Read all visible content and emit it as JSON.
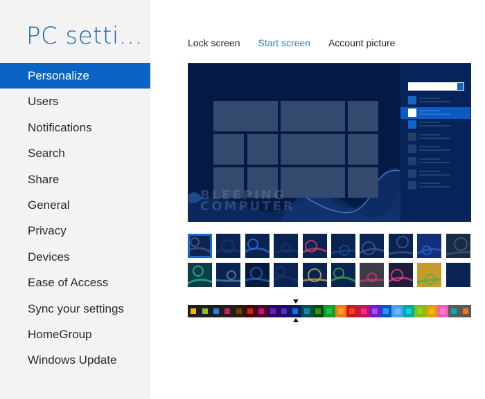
{
  "app": {
    "title": "PC setti..."
  },
  "sidebar": {
    "items": [
      {
        "label": "Personalize",
        "selected": true
      },
      {
        "label": "Users"
      },
      {
        "label": "Notifications"
      },
      {
        "label": "Search"
      },
      {
        "label": "Share"
      },
      {
        "label": "General"
      },
      {
        "label": "Privacy"
      },
      {
        "label": "Devices"
      },
      {
        "label": "Ease of Access"
      },
      {
        "label": "Sync your settings"
      },
      {
        "label": "HomeGroup"
      },
      {
        "label": "Windows Update"
      }
    ]
  },
  "tabs": [
    {
      "label": "Lock screen"
    },
    {
      "label": "Start screen",
      "active": true
    },
    {
      "label": "Account picture"
    }
  ],
  "preview": {
    "watermark_line1": "BLEEPING",
    "watermark_line2": "COMPUTER",
    "charm_rows": 8,
    "charm_selected_row": 1
  },
  "background_patterns": {
    "selected_index": 0,
    "items": [
      {
        "name": "pattern-arc",
        "colors": [
          "#0d2350",
          "#4a5f8a"
        ]
      },
      {
        "name": "pattern-lines",
        "colors": [
          "#0b2352",
          "#1d3a70"
        ]
      },
      {
        "name": "pattern-swirls",
        "colors": [
          "#0b2352",
          "#2f6fe0"
        ]
      },
      {
        "name": "pattern-blobs",
        "colors": [
          "#0b2352",
          "#163a75"
        ]
      },
      {
        "name": "pattern-flowers",
        "colors": [
          "#0b2352",
          "#d24a63"
        ]
      },
      {
        "name": "pattern-diagonal",
        "colors": [
          "#0b2352",
          "#1e4d92"
        ]
      },
      {
        "name": "pattern-fish",
        "colors": [
          "#0b2352",
          "#44608f"
        ]
      },
      {
        "name": "pattern-eye",
        "colors": [
          "#0b2352",
          "#3f5c8c"
        ]
      },
      {
        "name": "pattern-shards",
        "colors": [
          "#11307a",
          "#2f62c9"
        ]
      },
      {
        "name": "pattern-gears",
        "colors": [
          "#1a2b45",
          "#4b5d78"
        ]
      },
      {
        "name": "pattern-green-waves",
        "colors": [
          "#0d3d4d",
          "#26c08a"
        ]
      },
      {
        "name": "pattern-zebra",
        "colors": [
          "#0b2352",
          "#5a89a0"
        ]
      },
      {
        "name": "pattern-stars",
        "colors": [
          "#061a3c",
          "#2d62c8"
        ]
      },
      {
        "name": "pattern-rings",
        "colors": [
          "#0b2352",
          "#1b3a6e"
        ]
      },
      {
        "name": "pattern-horn",
        "colors": [
          "#0b2352",
          "#c8b25a"
        ]
      },
      {
        "name": "pattern-vines",
        "colors": [
          "#0b2352",
          "#36b04a"
        ]
      },
      {
        "name": "pattern-bird",
        "colors": [
          "#3b3b4a",
          "#d63b6a"
        ]
      },
      {
        "name": "pattern-tribal-flowers",
        "colors": [
          "#1e1e3a",
          "#e0429a"
        ]
      },
      {
        "name": "pattern-garden",
        "colors": [
          "#c79b2a",
          "#3fb04a"
        ]
      },
      {
        "name": "pattern-solid",
        "colors": [
          "#0b2352",
          "#0b2352"
        ]
      }
    ]
  },
  "color_schemes": {
    "selected_index": 9,
    "items": [
      {
        "bg": "#1f1f1f",
        "accent": "#f5b800"
      },
      {
        "bg": "#1f1f1f",
        "accent": "#8fc21d"
      },
      {
        "bg": "#1f1f1f",
        "accent": "#2a7ee8"
      },
      {
        "bg": "#1f1f1f",
        "accent": "#d41c58"
      },
      {
        "bg": "#2c1a0c",
        "accent": "#6b3d10"
      },
      {
        "bg": "#4a0606",
        "accent": "#c42a10"
      },
      {
        "bg": "#4a062c",
        "accent": "#c8165c"
      },
      {
        "bg": "#2a0a52",
        "accent": "#6a1cc4"
      },
      {
        "bg": "#1b0b6a",
        "accent": "#5a2ac8"
      },
      {
        "bg": "#03205c",
        "accent": "#1a6ae0"
      },
      {
        "bg": "#004c5c",
        "accent": "#0b8c9a"
      },
      {
        "bg": "#0a4a10",
        "accent": "#2a9a10"
      },
      {
        "bg": "#10a030",
        "accent": "#22c040"
      },
      {
        "bg": "#f07818",
        "accent": "#ffa020"
      },
      {
        "bg": "#c81c1c",
        "accent": "#ff3a1c"
      },
      {
        "bg": "#c81456",
        "accent": "#ff2a78"
      },
      {
        "bg": "#7818c8",
        "accent": "#a84af0"
      },
      {
        "bg": "#0c54c0",
        "accent": "#2a9af0"
      },
      {
        "bg": "#4aa0f0",
        "accent": "#6ab8ff"
      },
      {
        "bg": "#00a8a8",
        "accent": "#18d0d0"
      },
      {
        "bg": "#80c010",
        "accent": "#9ad020"
      },
      {
        "bg": "#e0a000",
        "accent": "#f0b818"
      },
      {
        "bg": "#f060b8",
        "accent": "#ff80c8"
      },
      {
        "bg": "#5a5a5a",
        "accent": "#10a8a0"
      },
      {
        "bg": "#5a5a5a",
        "accent": "#f07818"
      }
    ]
  }
}
